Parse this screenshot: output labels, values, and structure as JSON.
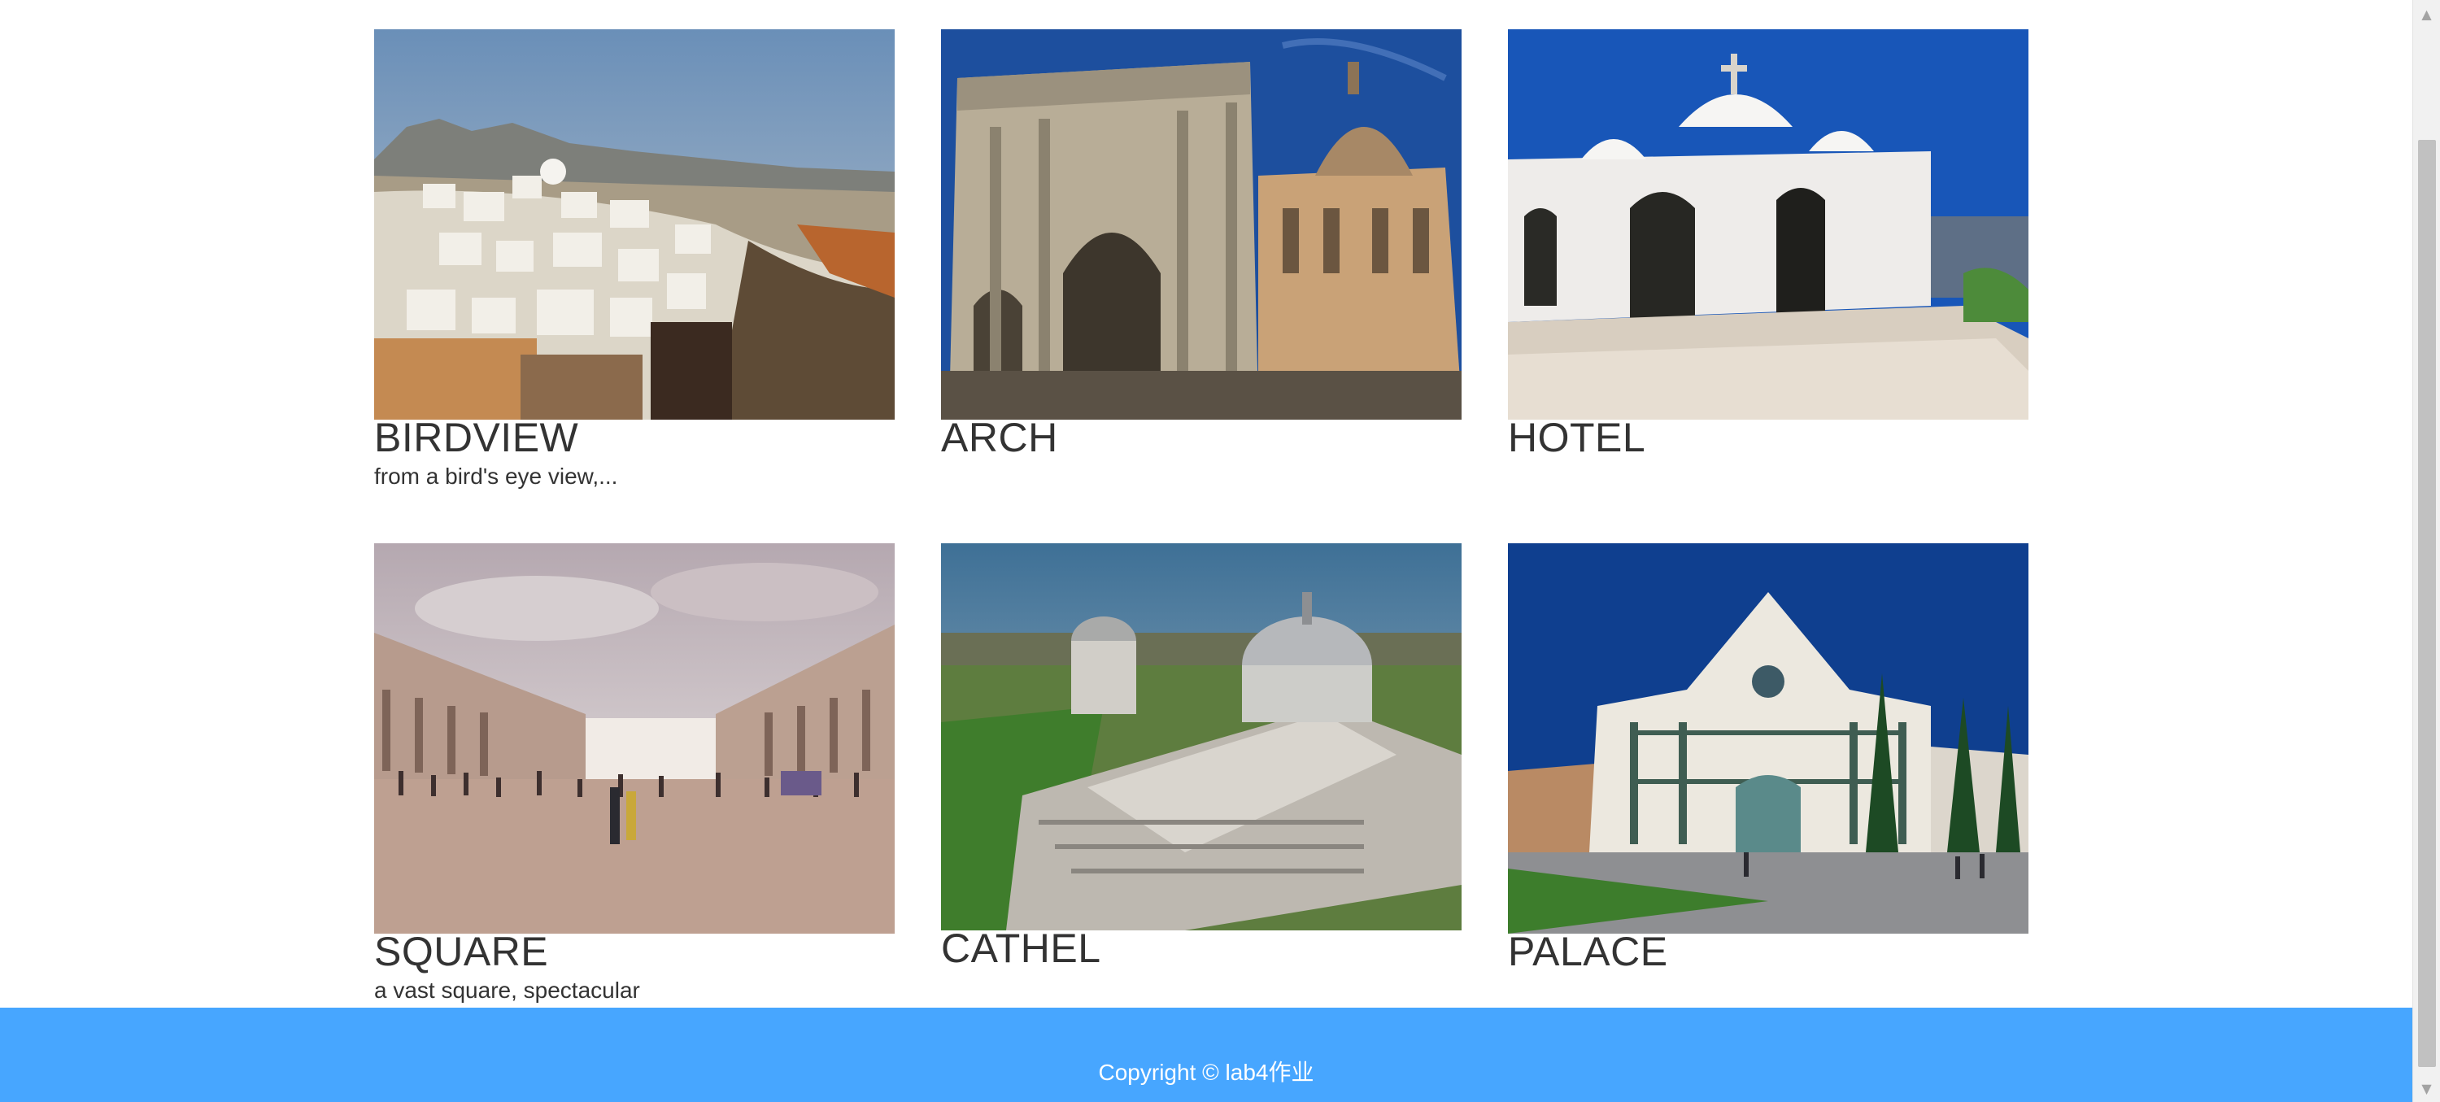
{
  "gallery": {
    "items": [
      {
        "title": "BIRDVIEW",
        "description": "from a bird's eye view,...",
        "image": "santorini-town-photo"
      },
      {
        "title": "ARCH",
        "description": "",
        "image": "roman-arch-photo"
      },
      {
        "title": "HOTEL",
        "description": "",
        "image": "white-chapel-photo"
      },
      {
        "title": "SQUARE",
        "description": "a vast square, spectacular",
        "image": "piazza-square-photo"
      },
      {
        "title": "CATHEL",
        "description": "",
        "image": "pisa-cathedral-photo"
      },
      {
        "title": "PALACE",
        "description": "",
        "image": "basilica-facade-photo"
      }
    ]
  },
  "footer": {
    "copyright": "Copyright © lab4作业"
  },
  "colors": {
    "footer_background": "#47a6ff",
    "footer_text": "#ffffff",
    "heading_text": "#333333"
  },
  "scrollbar": {
    "up_icon": "scroll-up-arrow-icon",
    "down_icon": "scroll-down-arrow-icon"
  }
}
